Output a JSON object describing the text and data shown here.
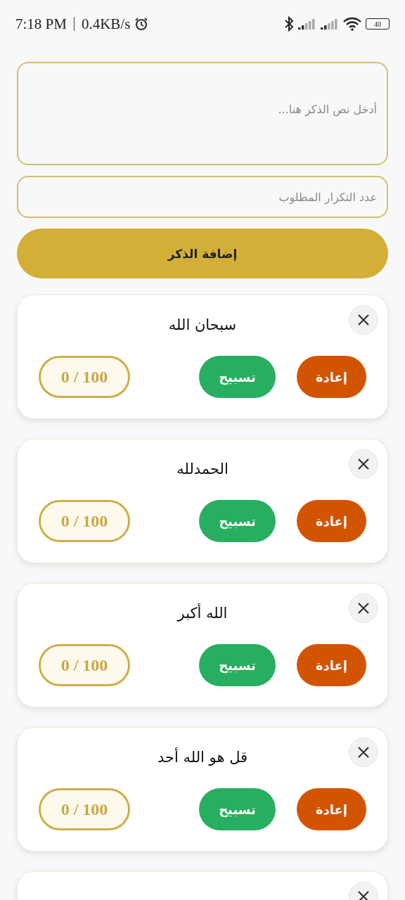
{
  "status_bar": {
    "time": "7:18 PM",
    "speed": "0.4KB/s",
    "battery": "40"
  },
  "form": {
    "text_placeholder": "أدخل نص الذكر هنا...",
    "count_placeholder": "عدد التكرار المطلوب",
    "add_button": "إضافة الذكر"
  },
  "cards": [
    {
      "kind": "full",
      "title": "سبحان الله",
      "reset": "إعادة",
      "count_button": "تسبيح",
      "counter": "0 / 100"
    },
    {
      "kind": "full",
      "title": "الحمدلله",
      "reset": "إعادة",
      "count_button": "تسبيح",
      "counter": "0 / 100"
    },
    {
      "kind": "full",
      "title": "الله أكبر",
      "reset": "إعادة",
      "count_button": "تسبيح",
      "counter": "0 / 100"
    },
    {
      "kind": "full",
      "title": "قل هو الله أحد",
      "reset": "إعادة",
      "count_button": "تسبيح",
      "counter": "0 / 100"
    },
    {
      "kind": "cut_off"
    }
  ]
}
